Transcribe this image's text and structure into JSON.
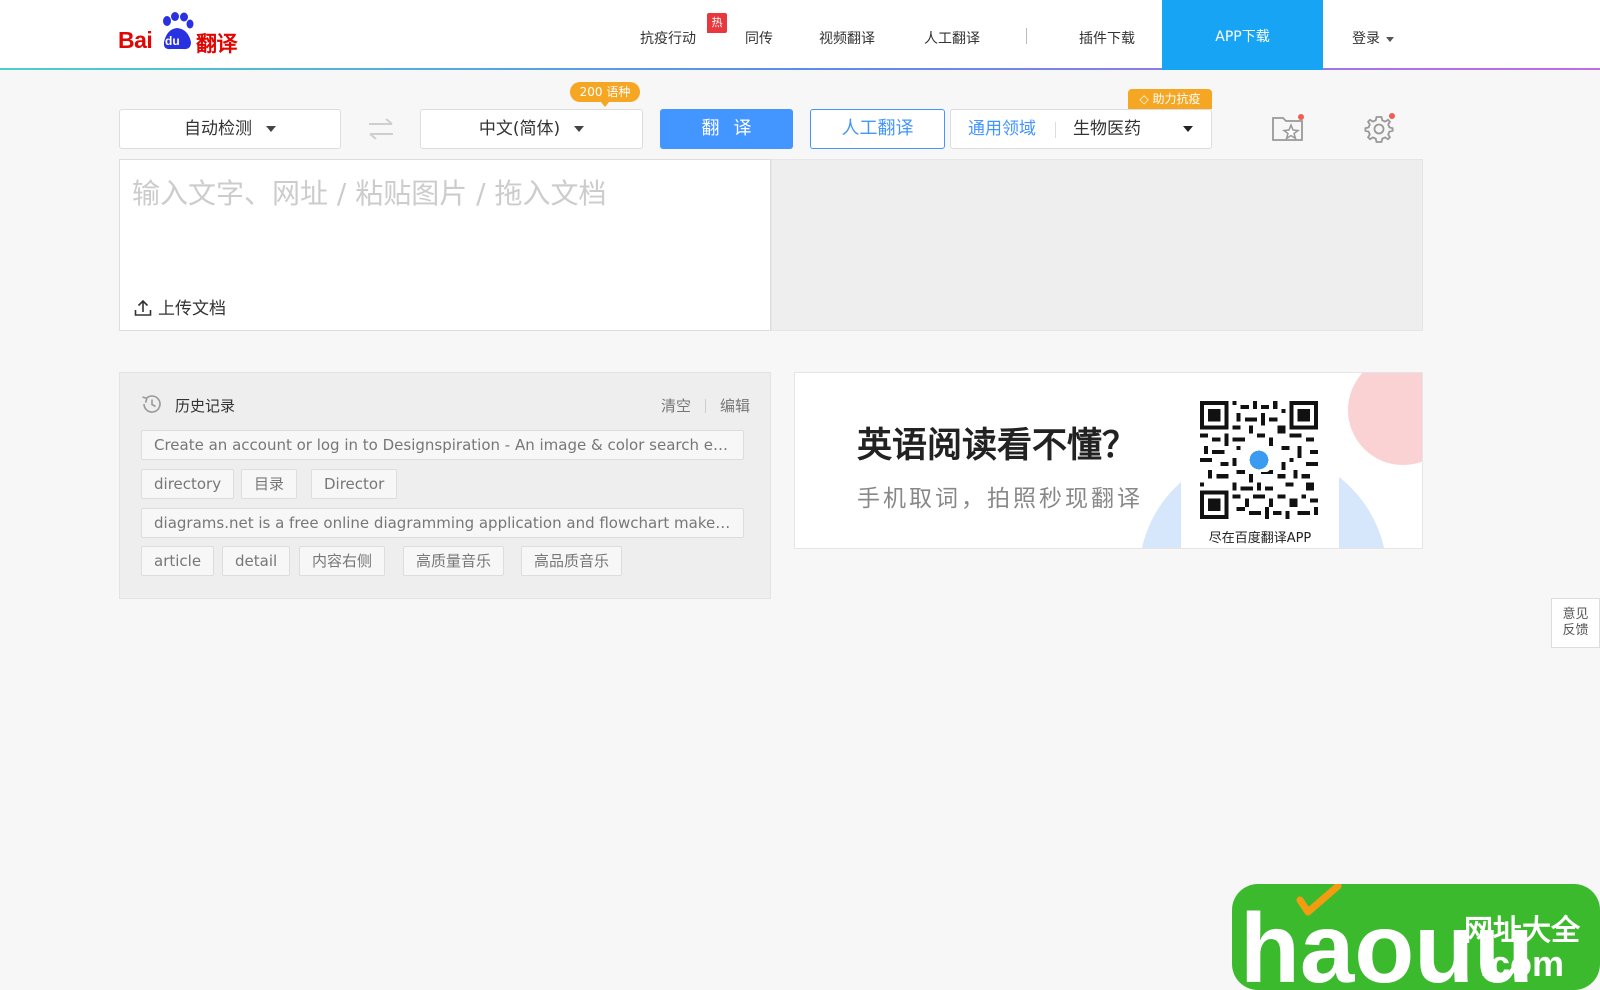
{
  "brand": {
    "logo_bai": "Bai",
    "logo_du": "du",
    "logo_fanyi": "翻译",
    "accent_color": "#4395ff",
    "brand_red": "#e10602"
  },
  "nav": {
    "items": [
      "抗疫行动",
      "同传",
      "视频翻译",
      "人工翻译",
      "插件下载"
    ],
    "hot_badge": "热",
    "app_download": "APP下载",
    "login": "登录"
  },
  "toolbar": {
    "source_lang": "自动检测",
    "target_lang": "中文(简体)",
    "lang_count_badge": "200 语种",
    "translate_label": "翻译",
    "human_translate_label": "人工翻译",
    "domain_label": "通用领域",
    "domain_value": "生物医药",
    "help_badge": "助力抗疫"
  },
  "input": {
    "placeholder": "输入文字、网址 / 粘贴图片 / 拖入文档",
    "upload_label": "上传文档"
  },
  "history": {
    "title": "历史记录",
    "clear": "清空",
    "edit": "编辑",
    "line1": "Create an account or log in to Designspiration - An image & color search engi...",
    "tags1": [
      "directory",
      "目录",
      "Director"
    ],
    "line2": "diagrams.net is a free online diagramming application and flowchart maker . Y...",
    "tags2": [
      "article",
      "detail",
      "内容右侧",
      "高质量音乐",
      "高品质音乐"
    ]
  },
  "ad": {
    "title": "英语阅读看不懂？",
    "subtitle": "手机取词，拍照秒现翻译",
    "qr_label": "尽在百度翻译APP"
  },
  "feedback": {
    "line1": "意见",
    "line2": "反馈"
  },
  "watermark": {
    "brand": "haouu",
    "cn": "网址大全",
    "com": ".com",
    "color": "#3cba2e"
  }
}
